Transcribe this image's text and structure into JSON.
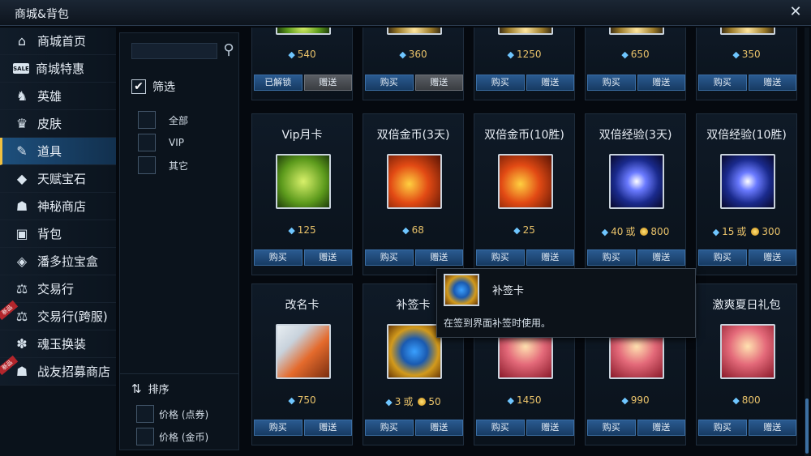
{
  "window": {
    "title": "商城&背包",
    "close_icon": "close-icon"
  },
  "sidebar": {
    "items": [
      {
        "label": "商城首页",
        "icon": "home-icon",
        "active": false,
        "new": false
      },
      {
        "label": "商城特惠",
        "icon": "sale-icon",
        "active": false,
        "new": false
      },
      {
        "label": "英雄",
        "icon": "hero-icon",
        "active": false,
        "new": false
      },
      {
        "label": "皮肤",
        "icon": "skin-icon",
        "active": false,
        "new": false
      },
      {
        "label": "道具",
        "icon": "item-icon",
        "active": true,
        "new": false
      },
      {
        "label": "天赋宝石",
        "icon": "gem-icon",
        "active": false,
        "new": false
      },
      {
        "label": "神秘商店",
        "icon": "mystery-shop-icon",
        "active": false,
        "new": false
      },
      {
        "label": "背包",
        "icon": "backpack-icon",
        "active": false,
        "new": false
      },
      {
        "label": "潘多拉宝盒",
        "icon": "pandora-box-icon",
        "active": false,
        "new": false
      },
      {
        "label": "交易行",
        "icon": "trade-icon",
        "active": false,
        "new": false
      },
      {
        "label": "交易行(跨服)",
        "icon": "trade-cross-icon",
        "active": false,
        "new": true
      },
      {
        "label": "魂玉换装",
        "icon": "soul-jade-icon",
        "active": false,
        "new": false
      },
      {
        "label": "战友招募商店",
        "icon": "recruit-shop-icon",
        "active": false,
        "new": true
      }
    ],
    "new_badge": "新品"
  },
  "filter": {
    "search_placeholder": "",
    "filter_title": "筛选",
    "options": [
      "全部",
      "VIP",
      "其它"
    ],
    "sort_title": "排序",
    "sort_options": [
      "价格 (点券)",
      "价格 (金币)"
    ]
  },
  "grid": {
    "buy_label": "购买",
    "gift_label": "赠送",
    "unlocked_label": "已解锁",
    "or_label": "或",
    "top_row": [
      {
        "price": "540",
        "left_btn": "已解锁",
        "gift_disabled": true,
        "art": "art-green"
      },
      {
        "price": "360",
        "left_btn": "购买",
        "gift_disabled": true,
        "art": "art-top"
      },
      {
        "price": "1250",
        "left_btn": "购买",
        "gift_disabled": false,
        "art": "art-top"
      },
      {
        "price": "650",
        "left_btn": "购买",
        "gift_disabled": false,
        "art": "art-top"
      },
      {
        "price": "350",
        "left_btn": "购买",
        "gift_disabled": false,
        "art": "art-top"
      }
    ],
    "middle_row": [
      {
        "name": "Vip月卡",
        "price_diamond": "125",
        "price_gold": "",
        "art": "art-green"
      },
      {
        "name": "双倍金币(3天)",
        "price_diamond": "68",
        "price_gold": "",
        "art": "art-gold"
      },
      {
        "name": "双倍金币(10胜)",
        "price_diamond": "25",
        "price_gold": "",
        "art": "art-gold"
      },
      {
        "name": "双倍经验(3天)",
        "price_diamond": "40",
        "price_gold": "800",
        "art": "art-blue"
      },
      {
        "name": "双倍经验(10胜)",
        "price_diamond": "15",
        "price_gold": "300",
        "art": "art-blue"
      }
    ],
    "bottom_row": [
      {
        "name": "改名卡",
        "price_diamond": "750",
        "price_gold": "",
        "art": "art-orange"
      },
      {
        "name": "补签卡",
        "price_diamond": "3",
        "price_gold": "50",
        "art": "art-gold2"
      },
      {
        "name": "",
        "price_diamond": "1450",
        "price_gold": "",
        "art": "art-pink"
      },
      {
        "name": "",
        "price_diamond": "990",
        "price_gold": "",
        "art": "art-pink"
      },
      {
        "name": "激爽夏日礼包",
        "price_diamond": "800",
        "price_gold": "",
        "art": "art-pink"
      }
    ]
  },
  "tooltip": {
    "name": "补签卡",
    "description": "在签到界面补签时使用。"
  },
  "colors": {
    "accent": "#1d4f7c",
    "gold": "#e9c26a",
    "button": "#2a5a90"
  }
}
